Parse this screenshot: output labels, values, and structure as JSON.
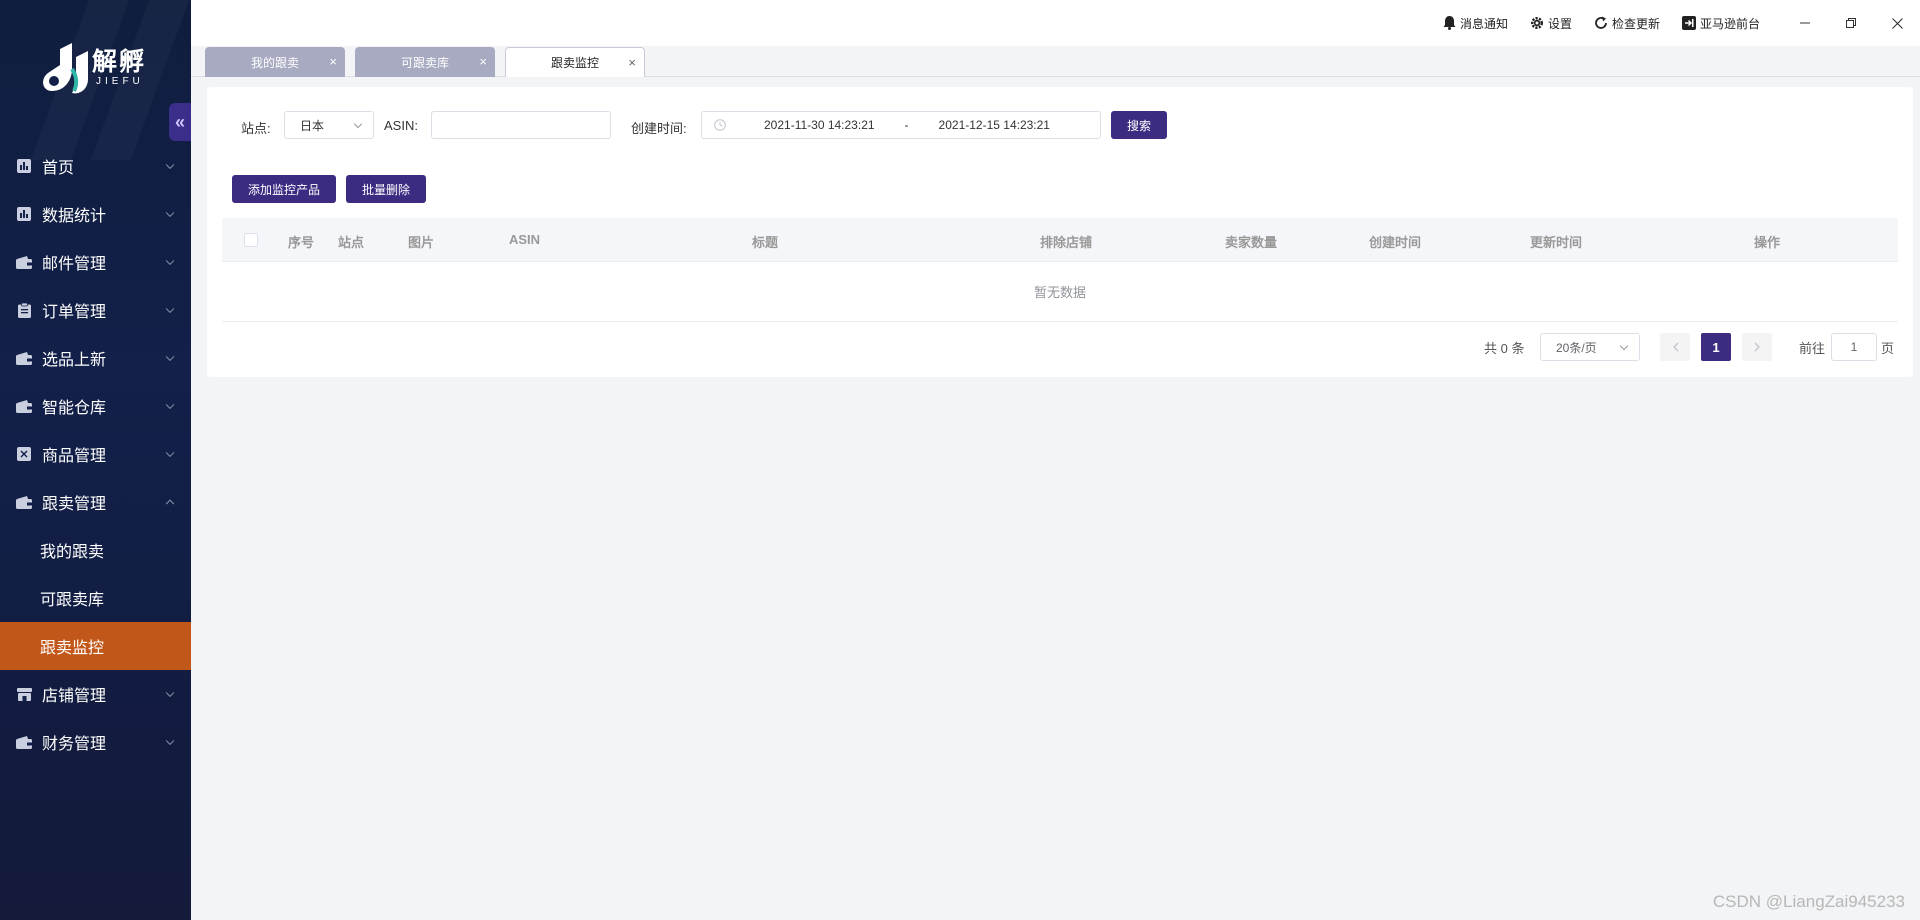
{
  "app": {
    "logo_cn": "解孵",
    "logo_en": "JIEFU"
  },
  "sidebar": {
    "collapse_glyph": "«",
    "items": [
      {
        "label": "首页",
        "icon": "bar-chart-icon"
      },
      {
        "label": "数据统计",
        "icon": "bar-chart-icon"
      },
      {
        "label": "邮件管理",
        "icon": "wallet-icon"
      },
      {
        "label": "订单管理",
        "icon": "clipboard-icon"
      },
      {
        "label": "选品上新",
        "icon": "wallet-icon"
      },
      {
        "label": "智能仓库",
        "icon": "wallet-icon"
      },
      {
        "label": "商品管理",
        "icon": "goods-icon"
      },
      {
        "label": "跟卖管理",
        "icon": "wallet-icon",
        "expanded": true
      }
    ],
    "sub_items": [
      {
        "label": "我的跟卖",
        "active": false
      },
      {
        "label": "可跟卖库",
        "active": false
      },
      {
        "label": "跟卖监控",
        "active": true
      }
    ],
    "items_after": [
      {
        "label": "店铺管理",
        "icon": "store-icon"
      },
      {
        "label": "财务管理",
        "icon": "wallet-icon"
      }
    ]
  },
  "topbar": {
    "notifications": "消息通知",
    "settings": "设置",
    "check_update": "检查更新",
    "amazon_front": "亚马逊前台"
  },
  "tabs": [
    {
      "label": "我的跟卖",
      "active": false
    },
    {
      "label": "可跟卖库",
      "active": false
    },
    {
      "label": "跟卖监控",
      "active": true
    }
  ],
  "filter": {
    "site_label": "站点:",
    "site_value": "日本",
    "asin_label": "ASIN:",
    "asin_value": "",
    "created_label": "创建时间:",
    "date_start": "2021-11-30 14:23:21",
    "date_sep": "-",
    "date_end": "2021-12-15 14:23:21",
    "search_btn": "搜索"
  },
  "actions": {
    "add_btn": "添加监控产品",
    "batch_delete_btn": "批量删除"
  },
  "table": {
    "columns": [
      "序号",
      "站点",
      "图片",
      "ASIN",
      "标题",
      "排除店铺",
      "卖家数量",
      "创建时间",
      "更新时间",
      "操作"
    ],
    "empty_text": "暂无数据"
  },
  "pagination": {
    "total": "共 0 条",
    "page_size": "20条/页",
    "current_page": "1",
    "goto_label": "前往",
    "goto_value": "1",
    "page_unit": "页"
  },
  "watermark": "CSDN @LiangZai945233",
  "colors": {
    "primary": "#3d2b82",
    "active_menu": "#c2571a",
    "sidebar_bg": "#12204a"
  }
}
